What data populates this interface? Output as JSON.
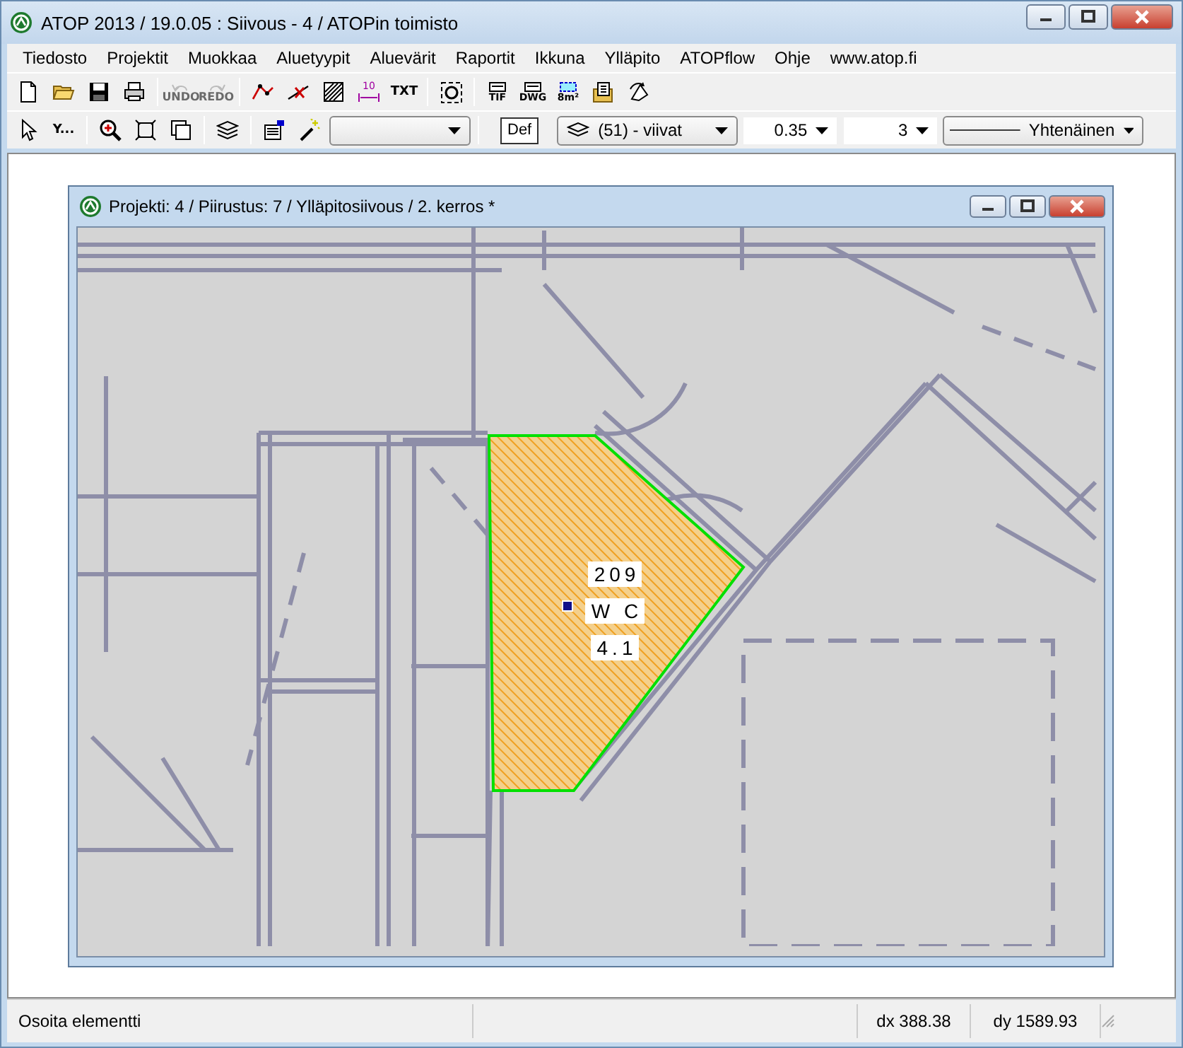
{
  "window": {
    "title": "ATOP 2013 / 19.0.05 : Siivous - 4 / ATOPin toimisto"
  },
  "menu": [
    "Tiedosto",
    "Projektit",
    "Muokkaa",
    "Aluetyypit",
    "Aluevärit",
    "Raportit",
    "Ikkuna",
    "Ylläpito",
    "ATOPflow",
    "Ohje",
    "www.atop.fi"
  ],
  "toolbar_1": [
    {
      "kind": "new",
      "disabled": false
    },
    {
      "kind": "open",
      "disabled": false
    },
    {
      "kind": "save",
      "disabled": false
    },
    {
      "kind": "print",
      "disabled": false
    },
    {
      "kind": "separator"
    },
    {
      "kind": "undo",
      "label": "UNDO",
      "disabled": true
    },
    {
      "kind": "redo",
      "label": "REDO",
      "disabled": true
    },
    {
      "kind": "separator"
    },
    {
      "kind": "polyline",
      "disabled": false
    },
    {
      "kind": "deleteline",
      "disabled": false
    },
    {
      "kind": "hatch",
      "disabled": false
    },
    {
      "kind": "dimension",
      "label": "10",
      "disabled": false
    },
    {
      "kind": "text",
      "label": "TXT",
      "disabled": false
    },
    {
      "kind": "separator"
    },
    {
      "kind": "target",
      "disabled": false
    },
    {
      "kind": "separator"
    },
    {
      "kind": "export",
      "label": "TIF",
      "disabled": false
    },
    {
      "kind": "export",
      "label": "DWG",
      "disabled": false
    },
    {
      "kind": "area",
      "label": "8m²",
      "disabled": false
    },
    {
      "kind": "report",
      "disabled": false
    },
    {
      "kind": "rotate",
      "disabled": false
    }
  ],
  "toolbar_2": [
    {
      "kind": "pointer"
    },
    {
      "kind": "filter",
      "label": "Y..."
    },
    {
      "kind": "separator"
    },
    {
      "kind": "zoom"
    },
    {
      "kind": "fit"
    },
    {
      "kind": "windows"
    },
    {
      "kind": "separator"
    },
    {
      "kind": "layers"
    },
    {
      "kind": "separator"
    },
    {
      "kind": "properties"
    },
    {
      "kind": "wand"
    },
    {
      "kind": "dropdown"
    },
    {
      "kind": "separator"
    },
    {
      "kind": "def",
      "label": "Def"
    },
    {
      "kind": "layer_dropdown",
      "value": "(51) - viivat"
    },
    {
      "kind": "value_dropdown",
      "value": "0.35"
    },
    {
      "kind": "value_dropdown",
      "value": "3"
    },
    {
      "kind": "linestyle_dropdown",
      "value": "Yhtenäinen"
    }
  ],
  "document": {
    "title": "Projekti: 4 / Piirustus: 7 / Ylläpitosiivous / 2. kerros *",
    "area": {
      "selected": true,
      "labels": [
        "209",
        "W C",
        "4.1"
      ]
    }
  },
  "status_bar": [
    "Osoita elementti",
    "dx 388.38",
    "dy 1589.93"
  ]
}
